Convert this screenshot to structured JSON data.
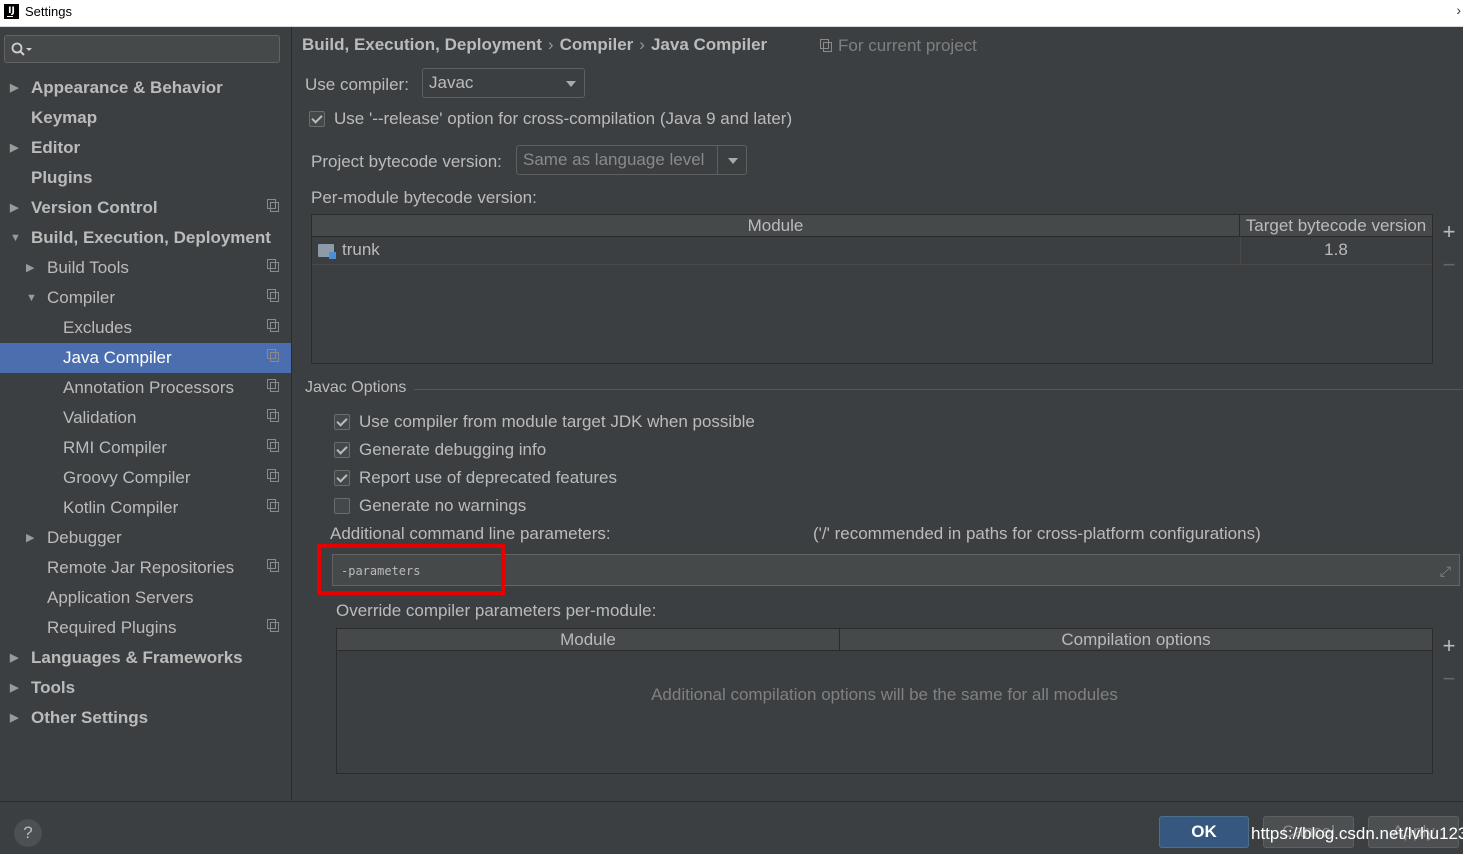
{
  "window": {
    "title": "Settings",
    "logo": "IJ"
  },
  "sidebar": {
    "items": [
      {
        "label": "Appearance & Behavior"
      },
      {
        "label": "Keymap"
      },
      {
        "label": "Editor"
      },
      {
        "label": "Plugins"
      },
      {
        "label": "Version Control"
      },
      {
        "label": "Build, Execution, Deployment"
      },
      {
        "label": "Build Tools"
      },
      {
        "label": "Compiler"
      },
      {
        "label": "Excludes"
      },
      {
        "label": "Java Compiler"
      },
      {
        "label": "Annotation Processors"
      },
      {
        "label": "Validation"
      },
      {
        "label": "RMI Compiler"
      },
      {
        "label": "Groovy Compiler"
      },
      {
        "label": "Kotlin Compiler"
      },
      {
        "label": "Debugger"
      },
      {
        "label": "Remote Jar Repositories"
      },
      {
        "label": "Application Servers"
      },
      {
        "label": "Required Plugins"
      },
      {
        "label": "Languages & Frameworks"
      },
      {
        "label": "Tools"
      },
      {
        "label": "Other Settings"
      }
    ],
    "selected": "Java Compiler"
  },
  "breadcrumb": {
    "part1": "Build, Execution, Deployment",
    "part2": "Compiler",
    "part3": "Java Compiler",
    "separator": "›"
  },
  "for_project": "For current project",
  "use_compiler": {
    "label": "Use compiler:",
    "value": "Javac"
  },
  "release_option": {
    "label": "Use '--release' option for cross-compilation (Java 9 and later)",
    "checked": true
  },
  "project_bytecode": {
    "label": "Project bytecode version:",
    "value": "Same as language level"
  },
  "per_module": {
    "label": "Per-module bytecode version:",
    "columns": [
      "Module",
      "Target bytecode version"
    ],
    "rows": [
      {
        "module": "trunk",
        "version": "1.8"
      }
    ]
  },
  "javac_options": {
    "title": "Javac Options",
    "checkboxes": [
      {
        "label": "Use compiler from module target JDK when possible",
        "checked": true
      },
      {
        "label": "Generate debugging info",
        "checked": true
      },
      {
        "label": "Report use of deprecated features",
        "checked": true
      },
      {
        "label": "Generate no warnings",
        "checked": false
      }
    ],
    "params_label": "Additional command line parameters:",
    "params_hint": "('/' recommended in paths for cross-platform configurations)",
    "params_value": "-parameters",
    "override_label": "Override compiler parameters per-module:",
    "override_columns": [
      "Module",
      "Compilation options"
    ],
    "override_empty": "Additional compilation options will be the same for all modules"
  },
  "footer": {
    "help": "?",
    "ok": "OK",
    "cancel": "Cancel",
    "apply": "Apply",
    "watermark": "https://blog.csdn.net/lvhu123"
  },
  "colors": {
    "selection": "#4b6eaf",
    "highlight_box": "#e60000",
    "ok_button": "#365880"
  }
}
